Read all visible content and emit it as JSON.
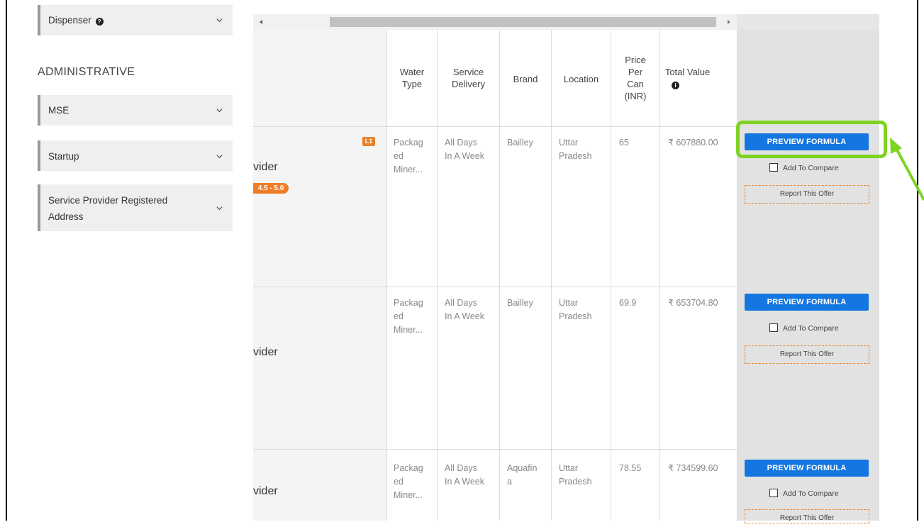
{
  "sidebar": {
    "filters": [
      {
        "label": "Dispenser",
        "has_help": true
      },
      {
        "label": "MSE"
      },
      {
        "label": "Startup"
      },
      {
        "label": "Service Provider Registered",
        "label2": "Address"
      }
    ],
    "section_title": "ADMINISTRATIVE"
  },
  "table": {
    "headers": {
      "water_type": [
        "Water",
        "Type"
      ],
      "service_delivery": [
        "Service",
        "Delivery"
      ],
      "brand": "Brand",
      "location": "Location",
      "price": [
        "Price",
        "Per",
        "Can",
        "(INR)"
      ],
      "total_value": "Total Value"
    },
    "rows": [
      {
        "provider_partial": "vider",
        "badge": "L1",
        "rating": "4.5 - 5.0",
        "water_type": [
          "Packag",
          "ed",
          "Miner..."
        ],
        "service_delivery": [
          "All Days",
          "In A Week"
        ],
        "brand": [
          "Bailley"
        ],
        "location": [
          "Uttar",
          "Pradesh"
        ],
        "price": "65",
        "total_value": "₹ 607880.00"
      },
      {
        "provider_partial": "vider",
        "water_type": [
          "Packag",
          "ed",
          "Miner..."
        ],
        "service_delivery": [
          "All Days",
          "In A Week"
        ],
        "brand": [
          "Bailley"
        ],
        "location": [
          "Uttar",
          "Pradesh"
        ],
        "price": "69.9",
        "total_value": "₹ 653704.80"
      },
      {
        "provider_partial": "vider",
        "water_type": [
          "Packag",
          "ed",
          "Miner..."
        ],
        "service_delivery": [
          "All Days",
          "In A Week"
        ],
        "brand": [
          "Aquafin",
          "a"
        ],
        "location": [
          "Uttar",
          "Pradesh"
        ],
        "price": "78.55",
        "total_value": "₹ 734599.60"
      }
    ]
  },
  "actions": {
    "preview_label": "PREVIEW FORMULA",
    "compare_label": "Add To Compare",
    "report_label": "Report This Offer"
  },
  "colors": {
    "primary_button": "#1476e0",
    "highlight": "#7ed321",
    "badge": "#e8812c"
  }
}
